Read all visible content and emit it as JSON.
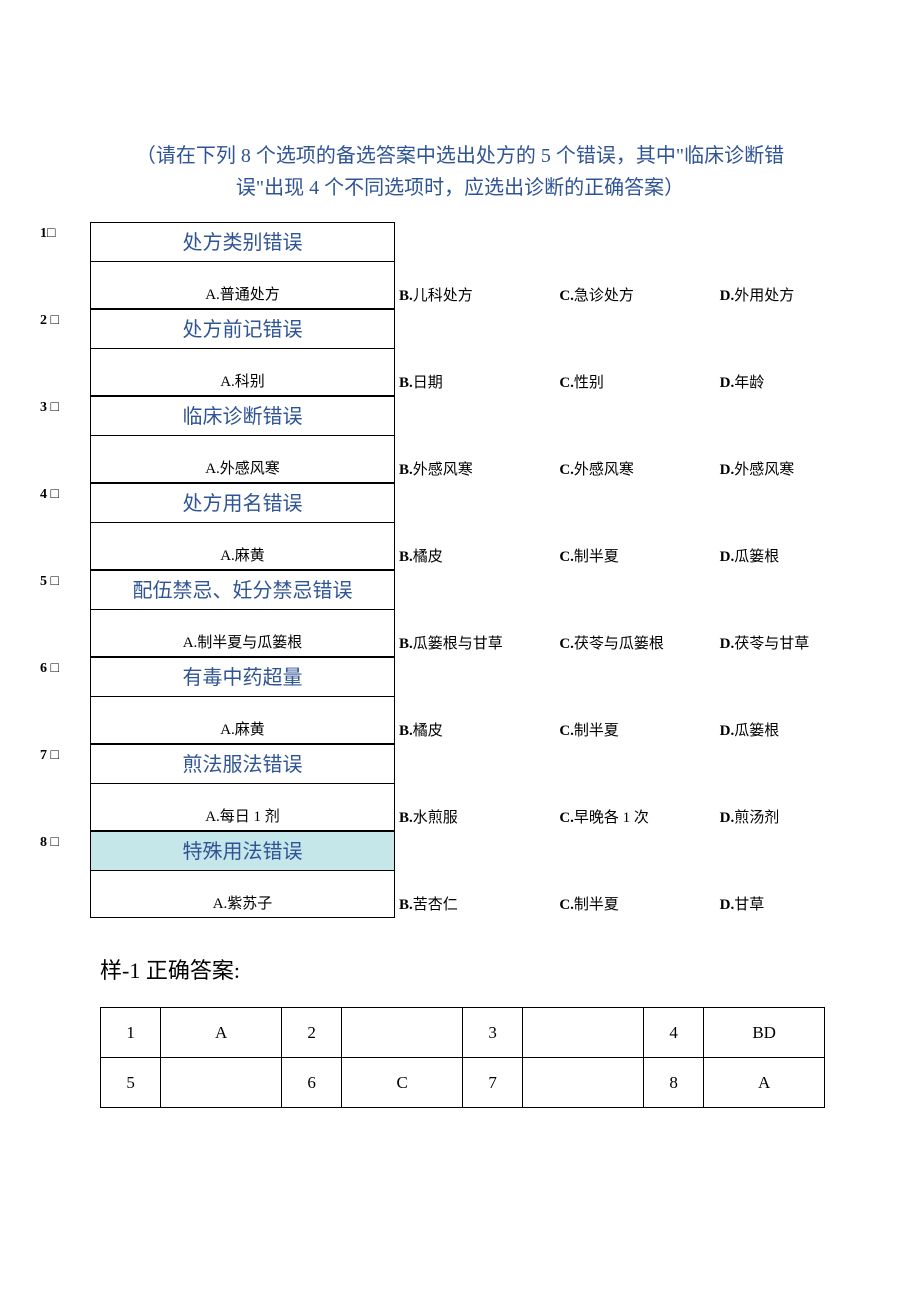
{
  "instruction": "（请在下列 8 个选项的备选答案中选出处方的 5 个错误，其中\"临床诊断错误\"出现 4 个不同选项时，应选出诊断的正确答案）",
  "questions": [
    {
      "num": "1",
      "box": "□",
      "title": "处方类别错误",
      "highlight": false,
      "opts": {
        "A": "普通处方",
        "B": "儿科处方",
        "C": "急诊处方",
        "D": "外用处方"
      }
    },
    {
      "num": "2",
      "box": " □",
      "title": "处方前记错误",
      "highlight": false,
      "opts": {
        "A": "科别",
        "B": "日期",
        "C": "性别",
        "D": "年龄"
      }
    },
    {
      "num": "3",
      "box": " □",
      "title": "临床诊断错误",
      "highlight": false,
      "opts": {
        "A": "外感风寒",
        "B": "外感风寒",
        "C": "外感风寒",
        "D": "外感风寒"
      }
    },
    {
      "num": "4",
      "box": " □",
      "title": "处方用名错误",
      "highlight": false,
      "opts": {
        "A": "麻黄",
        "B": "橘皮",
        "C": "制半夏",
        "D": "瓜篓根"
      }
    },
    {
      "num": "5",
      "box": " □",
      "title": "配伍禁忌、妊分禁忌错误",
      "highlight": false,
      "opts": {
        "A": "制半夏与瓜篓根",
        "B": "瓜篓根与甘草",
        "C": "茯苓与瓜篓根",
        "D": "茯苓与甘草"
      }
    },
    {
      "num": "6",
      "box": " □",
      "title": "有毒中药超量",
      "highlight": false,
      "opts": {
        "A": "麻黄",
        "B": "橘皮",
        "C": "制半夏",
        "D": "瓜篓根"
      }
    },
    {
      "num": "7",
      "box": " □",
      "title": "煎法服法错误",
      "highlight": false,
      "opts": {
        "A": "每日 1 剂",
        "B": "水煎服",
        "C": "早晚各 1 次",
        "D": "煎汤剂"
      }
    },
    {
      "num": "8",
      "box": " □",
      "title": "特殊用法错误",
      "highlight": true,
      "opts": {
        "A": "紫苏子",
        "B": "苦杏仁",
        "C": "制半夏",
        "D": "甘草"
      }
    }
  ],
  "answer_title": "样-1 正确答案:",
  "answers": [
    {
      "n": "1",
      "v": "A"
    },
    {
      "n": "2",
      "v": ""
    },
    {
      "n": "3",
      "v": ""
    },
    {
      "n": "4",
      "v": "BD"
    },
    {
      "n": "5",
      "v": ""
    },
    {
      "n": "6",
      "v": "C"
    },
    {
      "n": "7",
      "v": ""
    },
    {
      "n": "8",
      "v": "A"
    }
  ]
}
